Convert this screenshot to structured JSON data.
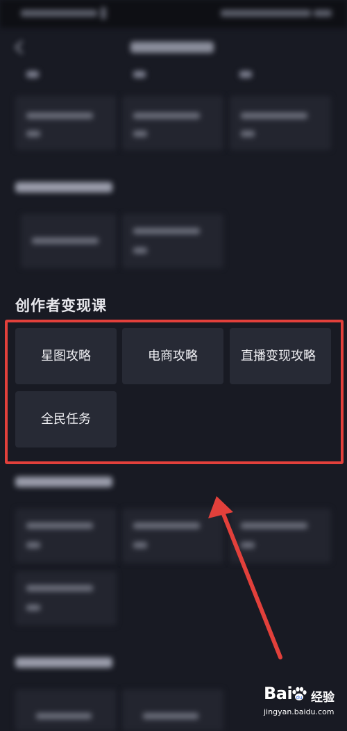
{
  "section": {
    "title": "创作者变现课",
    "courses": [
      {
        "label": "星图攻略"
      },
      {
        "label": "电商攻略"
      },
      {
        "label": "直播变现攻略"
      },
      {
        "label": "全民任务"
      }
    ]
  },
  "annotation": {
    "highlight_color": "#e2403b",
    "arrow_color": "#e2403b"
  },
  "watermark": {
    "brand": "Bai",
    "brand_suffix": "经验",
    "url": "jingyan.baidu.com",
    "icon": "paw-icon"
  },
  "icons": {
    "back": "chevron-left-icon"
  }
}
